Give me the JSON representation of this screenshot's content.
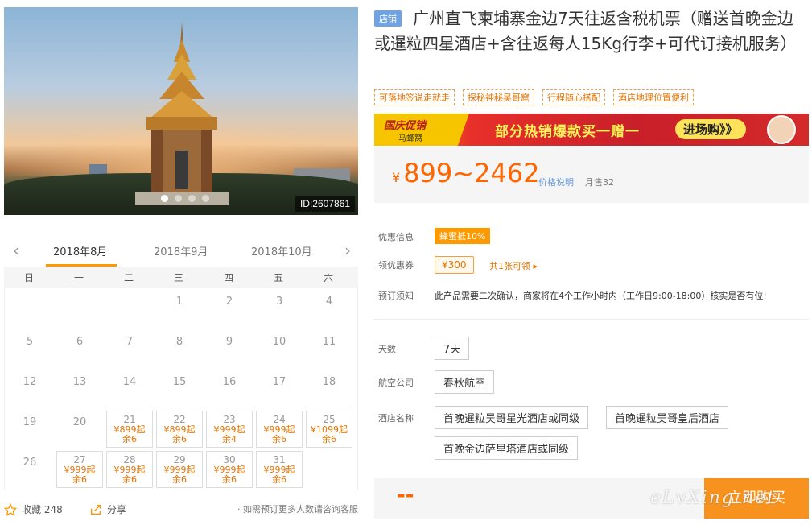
{
  "hero": {
    "image_id": "ID:2607861"
  },
  "calendar": {
    "prev_label": "‹",
    "next_label": "›",
    "tabs": [
      "2018年8月",
      "2018年9月",
      "2018年10月"
    ],
    "weekdays": [
      "日",
      "一",
      "二",
      "三",
      "四",
      "五",
      "六"
    ],
    "rows": [
      [
        {
          "d": ""
        },
        {
          "d": ""
        },
        {
          "d": ""
        },
        {
          "d": "1"
        },
        {
          "d": "2"
        },
        {
          "d": "3"
        },
        {
          "d": "4"
        }
      ],
      [
        {
          "d": "5"
        },
        {
          "d": "6"
        },
        {
          "d": "7"
        },
        {
          "d": "8"
        },
        {
          "d": "9"
        },
        {
          "d": "10"
        },
        {
          "d": "11"
        }
      ],
      [
        {
          "d": "12"
        },
        {
          "d": "13"
        },
        {
          "d": "14"
        },
        {
          "d": "15"
        },
        {
          "d": "16"
        },
        {
          "d": "17"
        },
        {
          "d": "18"
        }
      ],
      [
        {
          "d": "19"
        },
        {
          "d": "20"
        },
        {
          "d": "21",
          "p": "¥899起",
          "s": "余6"
        },
        {
          "d": "22",
          "p": "¥899起",
          "s": "余6"
        },
        {
          "d": "23",
          "p": "¥999起",
          "s": "余4"
        },
        {
          "d": "24",
          "p": "¥999起",
          "s": "余6"
        },
        {
          "d": "25",
          "p": "¥1099起",
          "s": "余6"
        }
      ],
      [
        {
          "d": "26"
        },
        {
          "d": "27",
          "p": "¥999起",
          "s": "余6"
        },
        {
          "d": "28",
          "p": "¥999起",
          "s": "余6"
        },
        {
          "d": "29",
          "p": "¥999起",
          "s": "余6"
        },
        {
          "d": "30",
          "p": "¥999起",
          "s": "余6"
        },
        {
          "d": "31",
          "p": "¥999起",
          "s": "余6"
        },
        {
          "d": ""
        }
      ]
    ]
  },
  "social": {
    "favorite": "收藏 248",
    "share": "分享",
    "note": "· 如需预订更多人数请咨询客服"
  },
  "product": {
    "badge": "店铺",
    "title": "广州直飞柬埔寨金边7天往返含税机票（赠送首晚金边或暹粒四星酒店+含往返每人15Kg行李+可代订接机服务）",
    "tags": [
      "可落地签说走就走",
      "探秘神秘吴哥窟",
      "行程随心搭配",
      "酒店地理位置便利"
    ]
  },
  "promo": {
    "brand_line1": "国庆促销",
    "brand_line2": "马蜂窝",
    "headline": "部分热销爆款买一赠一",
    "cta": "进场购》》"
  },
  "price": {
    "currency": "¥",
    "range": "899~2462",
    "explain": "价格说明",
    "sales": "月售32"
  },
  "info": {
    "discount_label": "优惠信息",
    "discount_value": "蜂蜜抵10%",
    "coupon_label": "领优惠券",
    "coupon_value": "¥300",
    "coupon_more": "共1张可领 ▸",
    "notice_label": "预订须知",
    "notice_value": "此产品需要二次确认，商家将在4个工作小时内（工作日9:00-18:00）核实是否有位!"
  },
  "options": {
    "days_label": "天数",
    "days_value": "7天",
    "airline_label": "航空公司",
    "airline_value": "春秋航空",
    "hotel_label": "酒店名称",
    "hotels": [
      "首晚暹粒吴哥星光酒店或同级",
      "首晚暹粒吴哥皇后酒店",
      "首晚金边萨里塔酒店或同级"
    ]
  },
  "buy": {
    "price": "--",
    "button": "立即购买",
    "watermark": "eLvXing.net"
  }
}
